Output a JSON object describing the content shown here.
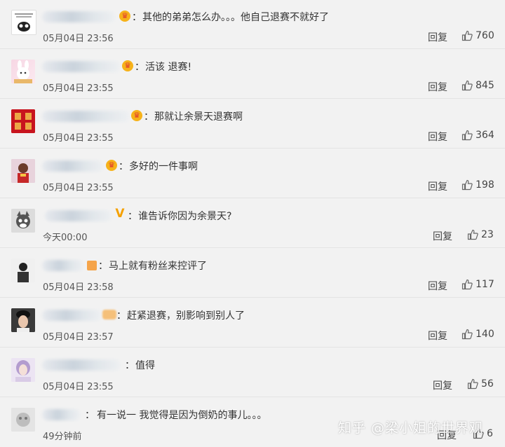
{
  "comments": [
    {
      "text": "其他的弟弟怎么办。。。他自己退赛不就好了",
      "time": "05月04日 23:56",
      "reply": "回复",
      "likes": "760",
      "colon": "："
    },
    {
      "text": "活该 退赛!",
      "time": "05月04日 23:55",
      "reply": "回复",
      "likes": "845",
      "colon": "："
    },
    {
      "text": "那就让余景天退赛啊",
      "time": "05月04日 23:55",
      "reply": "回复",
      "likes": "364",
      "colon": "："
    },
    {
      "text": "多好的一件事啊",
      "time": "05月04日 23:55",
      "reply": "回复",
      "likes": "198",
      "colon": "："
    },
    {
      "text": "谁告诉你因为余景天?",
      "time": "今天00:00",
      "reply": "回复",
      "likes": "23",
      "colon": "："
    },
    {
      "text": "马上就有粉丝来控评了",
      "time": "05月04日 23:58",
      "reply": "回复",
      "likes": "117",
      "colon": "："
    },
    {
      "text": "赶紧退赛，别影响到别人了",
      "time": "05月04日 23:57",
      "reply": "回复",
      "likes": "140",
      "colon": "："
    },
    {
      "text": "值得",
      "time": "05月04日 23:55",
      "reply": "回复",
      "likes": "56",
      "colon": "："
    },
    {
      "text": "有一说一 我觉得是因为倒奶的事儿。。。",
      "time": "49分钟前",
      "reply": "回复",
      "likes": "6",
      "colon": "："
    }
  ],
  "watermark": "知乎 @梁小姐的世界观",
  "icons": {
    "like": "thumbs-up-icon",
    "crown": "crown-badge-icon",
    "vip": "vip-v-icon"
  },
  "colors": {
    "background": "#f2f2f2",
    "crown": "#f6b21a",
    "vip": "#f5a100"
  }
}
